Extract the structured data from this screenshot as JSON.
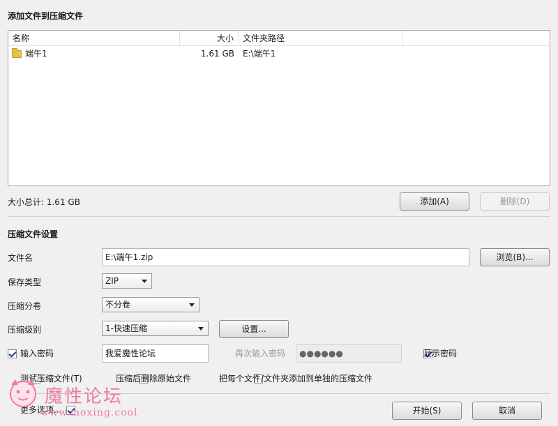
{
  "add_section": {
    "title": "添加文件到压缩文件",
    "columns": {
      "name": "名称",
      "size": "大小",
      "path": "文件夹路径"
    },
    "rows": [
      {
        "name": "端午1",
        "size": "1.61 GB",
        "path": "E:\\端午1"
      }
    ],
    "total": "大小总计: 1.61 GB",
    "add_button": "添加(A)",
    "delete_button": "删除(D)"
  },
  "settings": {
    "title": "压缩文件设置",
    "filename_label": "文件名",
    "filename_value": "E:\\端午1.zip",
    "browse_button": "浏览(B)...",
    "save_type_label": "保存类型",
    "save_type_value": "ZIP",
    "volume_label": "压缩分卷",
    "volume_value": "不分卷",
    "level_label": "压缩级别",
    "level_value": "1-快速压缩",
    "settings_button": "设置...",
    "password_label": "输入密码",
    "password_checked": true,
    "password_value": "我爱魔性论坛",
    "confirm_label": "再次输入密码",
    "confirm_value": "●●●●●●",
    "show_password_label": "显示密码",
    "show_password_checked": true,
    "test_label": "测试压缩文件(T)",
    "test_checked": false,
    "delete_after_label": "压缩后删除原始文件",
    "delete_after_checked": false,
    "separate_label": "把每个文件/文件夹添加到单独的压缩文件",
    "separate_checked": false
  },
  "footer": {
    "more_options_label": "更多选项...",
    "more_options_checked": true,
    "start_button": "开始(S)",
    "cancel_button": "取消"
  },
  "watermark": {
    "title": "魔性论坛",
    "url": "www.moxing.cool"
  }
}
